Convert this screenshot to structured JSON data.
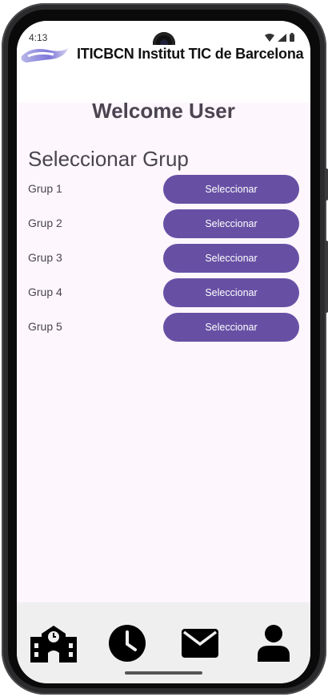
{
  "status_bar": {
    "time": "4:13"
  },
  "header": {
    "title": "ITICBCN Institut TIC de Barcelona",
    "logo_icon": "iticbcn-logo-icon"
  },
  "main": {
    "welcome": "Welcome User",
    "section_title": "Seleccionar Grup",
    "groups": [
      {
        "label": "Grup 1",
        "button": "Seleccionar"
      },
      {
        "label": "Grup 2",
        "button": "Seleccionar"
      },
      {
        "label": "Grup 3",
        "button": "Seleccionar"
      },
      {
        "label": "Grup 4",
        "button": "Seleccionar"
      },
      {
        "label": "Grup 5",
        "button": "Seleccionar"
      }
    ]
  },
  "bottom_nav": {
    "items": [
      {
        "icon": "school-icon"
      },
      {
        "icon": "clock-icon"
      },
      {
        "icon": "mail-icon"
      },
      {
        "icon": "person-icon"
      }
    ]
  },
  "colors": {
    "accent": "#6750a4",
    "background": "#fdf6fd",
    "nav_background": "#efefef"
  }
}
